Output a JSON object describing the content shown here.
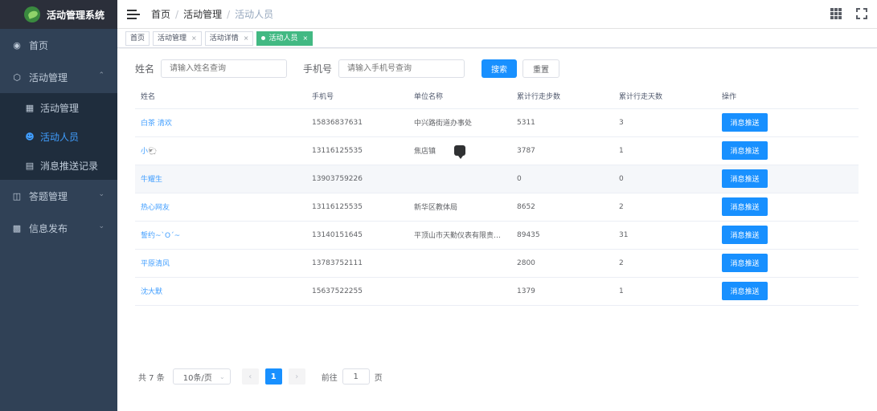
{
  "app": {
    "title": "活动管理系统"
  },
  "sidebar": {
    "items": [
      {
        "label": "首页",
        "icon": "dashboard-icon"
      },
      {
        "label": "活动管理",
        "icon": "cube-icon",
        "expanded": true,
        "children": [
          {
            "label": "活动管理",
            "icon": "sitemap-icon"
          },
          {
            "label": "活动人员",
            "icon": "people-icon",
            "active": true
          },
          {
            "label": "消息推送记录",
            "icon": "log-icon"
          }
        ]
      },
      {
        "label": "答题管理",
        "icon": "book-icon"
      },
      {
        "label": "信息发布",
        "icon": "doc-icon"
      }
    ]
  },
  "breadcrumb": [
    "首页",
    "活动管理",
    "活动人员"
  ],
  "tags": [
    {
      "label": "首页",
      "close": ""
    },
    {
      "label": "活动管理",
      "close": "×"
    },
    {
      "label": "活动详情",
      "close": "×"
    },
    {
      "label": "活动人员",
      "close": "×",
      "active": true
    }
  ],
  "search": {
    "name_label": "姓名",
    "name_placeholder": "请输入姓名查询",
    "phone_label": "手机号",
    "phone_placeholder": "请输入手机号查询",
    "search_button": "搜索",
    "reset_button": "重置"
  },
  "table": {
    "columns": [
      "姓名",
      "手机号",
      "单位名称",
      "累计行走步数",
      "累计行走天数",
      "操作"
    ],
    "action_label": "消息推送",
    "rows": [
      {
        "name": "白茶 清欢",
        "phone": "15836837631",
        "unit": "中兴路街道办事处",
        "steps": "5311",
        "days": "3"
      },
      {
        "name": "小🐑",
        "phone": "13116125535",
        "unit": "焦店镇",
        "steps": "3787",
        "days": "1"
      },
      {
        "name": "牛耀生",
        "phone": "13903759226",
        "unit": "",
        "steps": "0",
        "days": "0"
      },
      {
        "name": "热心网友",
        "phone": "13116125535",
        "unit": "新华区教体局",
        "steps": "8652",
        "days": "2"
      },
      {
        "name": "誓约~`O´~",
        "phone": "13140151645",
        "unit": "平顶山市天勤仪表有限责任公司",
        "steps": "89435",
        "days": "31"
      },
      {
        "name": "平原清风",
        "phone": "13783752111",
        "unit": "",
        "steps": "2800",
        "days": "2"
      },
      {
        "name": "沈大默",
        "phone": "15637522255",
        "unit": "",
        "steps": "1379",
        "days": "1"
      }
    ]
  },
  "pagination": {
    "total": "共 7 条",
    "page_size": "10条/页",
    "prev": "‹",
    "current": "1",
    "next": "›",
    "goto_label": "前往",
    "goto_value": "1",
    "goto_suffix": "页"
  },
  "colors": {
    "sidebar_bg": "#304156",
    "primary": "#1890ff",
    "active_tag": "#42b983"
  }
}
